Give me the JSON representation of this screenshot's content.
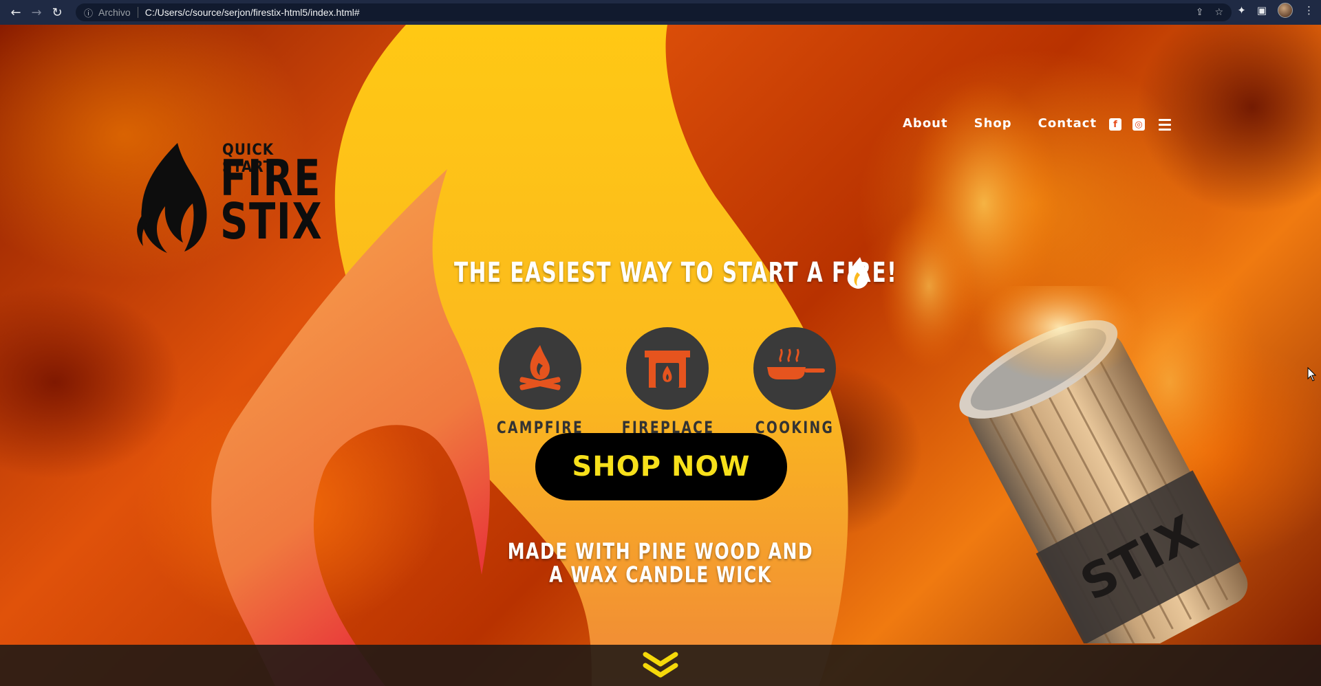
{
  "browser": {
    "scheme_label": "Archivo",
    "url": "C:/Users/c/source/serjon/firestix-html5/index.html#"
  },
  "logo": {
    "subtitle": "QUICK START",
    "line1": "FIRE",
    "line2": "STIX"
  },
  "nav": {
    "items": [
      "About",
      "Shop",
      "Contact"
    ]
  },
  "social": {
    "facebook_glyph": "f",
    "instagram_glyph": "◎"
  },
  "hero": {
    "headline": "THE EASIEST WAY TO START A FIRE!",
    "features": [
      {
        "label": "CAMPFIRE",
        "icon": "campfire-icon"
      },
      {
        "label": "FIREPLACE",
        "icon": "fireplace-icon"
      },
      {
        "label": "COOKING",
        "icon": "cooking-pan-icon"
      }
    ],
    "cta_label": "SHOP NOW",
    "tagline_line1": "MADE WITH PINE WOOD AND",
    "tagline_line2": "A WAX CANDLE WICK",
    "bundle_print": "STIX"
  },
  "colors": {
    "cta_text": "#f7e01b",
    "icon_orange": "#e6541e",
    "circle": "#3a3a3a",
    "scroll_chevron": "#f5d90a"
  }
}
